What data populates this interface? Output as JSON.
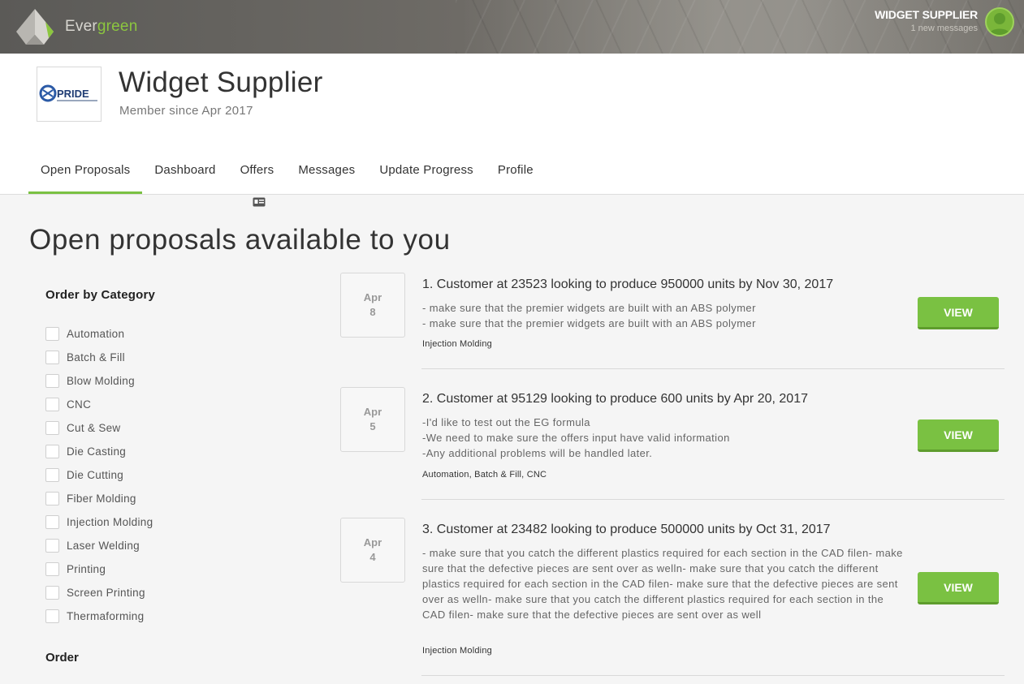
{
  "topbar": {
    "brand_prefix": "Ever",
    "brand_suffix": "green",
    "user_name": "WIDGET SUPPLIER",
    "user_messages": "1 new messages"
  },
  "header": {
    "company_logo_text": "PRIDE",
    "company_name": "Widget Supplier",
    "member_since": "Member since Apr 2017"
  },
  "tabs": [
    {
      "label": "Open Proposals",
      "active": true
    },
    {
      "label": "Dashboard",
      "active": false
    },
    {
      "label": "Offers",
      "active": false
    },
    {
      "label": "Messages",
      "active": false
    },
    {
      "label": "Update Progress",
      "active": false
    },
    {
      "label": "Profile",
      "active": false
    }
  ],
  "page_title": "Open proposals available to you",
  "sidebar": {
    "category_heading": "Order by Category",
    "categories": [
      "Automation",
      "Batch & Fill",
      "Blow Molding",
      "CNC",
      "Cut & Sew",
      "Die Casting",
      "Die Cutting",
      "Fiber Molding",
      "Injection Molding",
      "Laser Welding",
      "Printing",
      "Screen Printing",
      "Thermaforming"
    ],
    "order_heading": "Order"
  },
  "proposals": [
    {
      "month": "Apr",
      "day": "8",
      "title": "1. Customer at 23523 looking to produce 950000 units by Nov 30, 2017",
      "lines": [
        "- make sure that the premier widgets are built with an ABS polymer",
        "- make sure that the premier widgets are built with an ABS polymer"
      ],
      "tags": "Injection Molding",
      "button": "VIEW"
    },
    {
      "month": "Apr",
      "day": "5",
      "title": "2. Customer at 95129 looking to produce 600 units by Apr 20, 2017",
      "lines": [
        "-I'd like to test out the EG formula",
        "-We need to make sure the offers input have valid information",
        "-Any additional problems will be handled later."
      ],
      "tags": "Automation, Batch & Fill, CNC",
      "button": "VIEW"
    },
    {
      "month": "Apr",
      "day": "4",
      "title": "3. Customer at 23482 looking to produce 500000 units by Oct 31, 2017",
      "lines": [
        "- make sure that you catch the different plastics required for each section in the CAD filen- make sure that the defective pieces are sent over as welln- make sure that you catch the different plastics required for each section in the CAD filen- make sure that the defective pieces are sent over as welln- make sure that you catch the different plastics required for each section in the CAD filen- make sure that the defective pieces are sent over as well"
      ],
      "tags": "Injection Molding",
      "button": "VIEW"
    }
  ],
  "colors": {
    "accent": "#7ac142",
    "topbar": "#6e6b66"
  }
}
